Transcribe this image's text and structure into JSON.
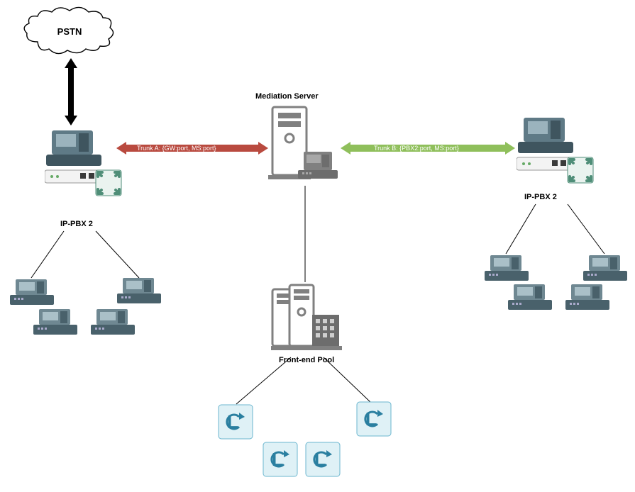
{
  "pstn": {
    "label": "PSTN"
  },
  "mediation": {
    "label": "Mediation Server"
  },
  "frontend": {
    "label": "Front-end Pool"
  },
  "pbx_left": {
    "label": "IP-PBX 2"
  },
  "pbx_right": {
    "label": "IP-PBX 2"
  },
  "trunk_a": {
    "label": "Trunk A: {GW:port, MS:port}"
  },
  "trunk_b": {
    "label": "Trunk B: {PBX2:port, MS:port}"
  }
}
